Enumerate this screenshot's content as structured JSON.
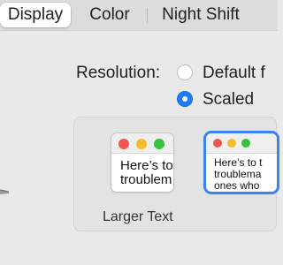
{
  "tabs": [
    {
      "label": "Display",
      "active": true
    },
    {
      "label": "Color",
      "active": false
    },
    {
      "label": "Night Shift",
      "active": false
    }
  ],
  "resolution": {
    "label": "Resolution:",
    "options": [
      {
        "label": "Default f",
        "selected": false
      },
      {
        "label": "Scaled",
        "selected": true
      }
    ]
  },
  "scaling": {
    "previews": [
      {
        "text": "Here’s to t\ntroublem",
        "selected": false
      },
      {
        "text": "Here’s to t\ntroublema\nones who",
        "selected": true
      }
    ],
    "captions": [
      "Larger Text"
    ]
  },
  "colors": {
    "accent": "#1c7cf4",
    "selection_ring": "#3a82f6",
    "traffic_red": "#f0564f",
    "traffic_yellow": "#f6bc2e",
    "traffic_green": "#36c43f"
  }
}
